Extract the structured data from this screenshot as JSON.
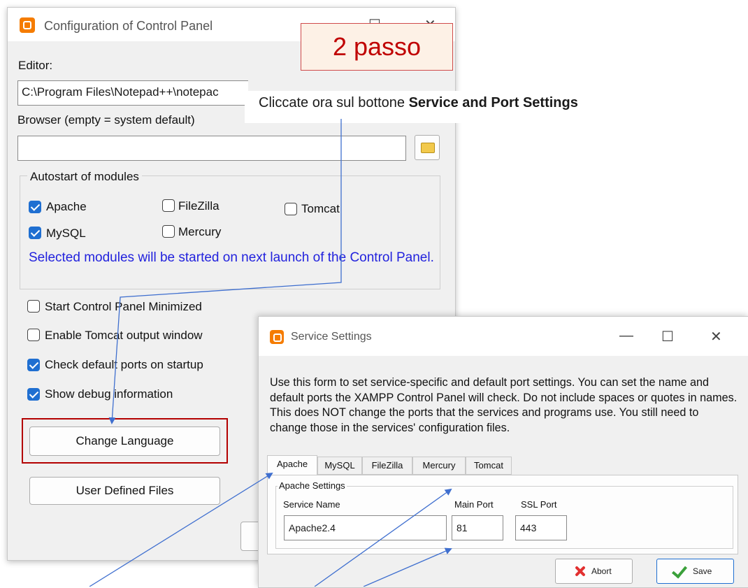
{
  "config_window": {
    "title": "Configuration of Control Panel",
    "editor_label": "Editor:",
    "editor_value": "C:\\Program Files\\Notepad++\\notepac",
    "browser_label": "Browser (empty = system default)",
    "browser_value": "",
    "autostart_title": "Autostart of modules",
    "modules": [
      {
        "label": "Apache",
        "checked": true
      },
      {
        "label": "FileZilla",
        "checked": false
      },
      {
        "label": "Tomcat",
        "checked": false
      },
      {
        "label": "MySQL",
        "checked": true
      },
      {
        "label": "Mercury",
        "checked": false
      }
    ],
    "autostart_note": "Selected modules will be started on next launch of the Control Panel.",
    "options": [
      {
        "label": "Start Control Panel Minimized",
        "checked": false
      },
      {
        "label": "Enable Tomcat output window",
        "checked": false
      },
      {
        "label": "Check default ports on startup",
        "checked": true
      },
      {
        "label": "Show debug information",
        "checked": true
      }
    ],
    "change_language_label": "Change Language",
    "user_defined_files_label": "User Defined Files",
    "minimize_glyph": "☐",
    "close_glyph": "✕"
  },
  "annotation": {
    "step_label": "2 passo",
    "instruction_prefix": "Cliccate ora sul bottone ",
    "instruction_bold": "Service and Port Settings",
    "highlight_color": "#b30000"
  },
  "service_window": {
    "title": "Service Settings",
    "minimize_glyph": "—",
    "maximize_glyph": "☐",
    "close_glyph": "✕",
    "description": "Use this form to set service-specific and default port settings.  You can set the name and default ports the XAMPP Control Panel will check.  Do not include spaces or quotes in names.  This does NOT change the ports that the services and programs use.  You still need to change those in the services' configuration files.",
    "tabs": [
      "Apache",
      "MySQL",
      "FileZilla",
      "Mercury",
      "Tomcat"
    ],
    "active_tab": "Apache",
    "group_title": "Apache Settings",
    "service_name_label": "Service Name",
    "main_port_label": "Main Port",
    "ssl_port_label": "SSL Port",
    "service_name_value": "Apache2.4",
    "main_port_value": "81",
    "ssl_port_value": "443",
    "abort_label": "Abort",
    "save_label": "Save"
  },
  "icons": [
    "xampp-logo-icon",
    "folder-icon",
    "abort-x-icon",
    "save-check-icon"
  ]
}
